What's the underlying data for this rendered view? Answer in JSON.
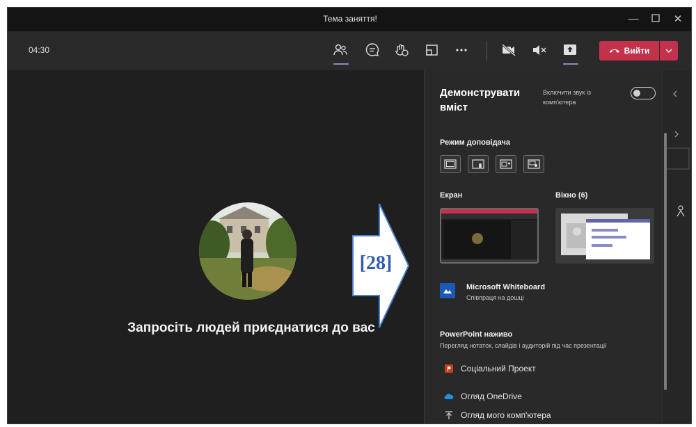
{
  "window": {
    "title": "Тема заняття!",
    "controls": [
      "minimize-icon",
      "maximize-icon",
      "close-icon"
    ]
  },
  "toolbar": {
    "timer": "04:30",
    "icons": [
      "people-icon",
      "chat-icon",
      "reactions-icon",
      "rooms-icon",
      "more-icon",
      "camera-off-icon",
      "mic-muted-icon",
      "share-icon"
    ],
    "leave_label": "Вийти",
    "leave_color": "#c4314b",
    "accent_color": "#8b8cc7"
  },
  "stage": {
    "invite_text": "Запросіть людей приєднатися до вас"
  },
  "annotation": {
    "label": "[28]",
    "color": "#2e5eb0"
  },
  "share_panel": {
    "title": "Демонструвати вміст",
    "include_sound_label": "Включити звук із комп'ютера",
    "include_sound_on": false,
    "presenter_mode_label": "Режим доповідача",
    "presenter_modes": [
      "content-only-icon",
      "standout-icon",
      "side-by-side-icon",
      "reporter-icon"
    ],
    "screen_label": "Екран",
    "window_label": "Вікно (6)",
    "whiteboard": {
      "title": "Microsoft Whiteboard",
      "subtitle": "Співпраця на дошці"
    },
    "powerpoint": {
      "title": "PowerPoint наживо",
      "subtitle": "Перегляд нотаток, слайдів і аудиторій під час презентації",
      "file": "Соціальний Проект"
    },
    "browse_onedrive": "Огляд OneDrive",
    "browse_computer": "Огляд мого комп'ютера"
  }
}
